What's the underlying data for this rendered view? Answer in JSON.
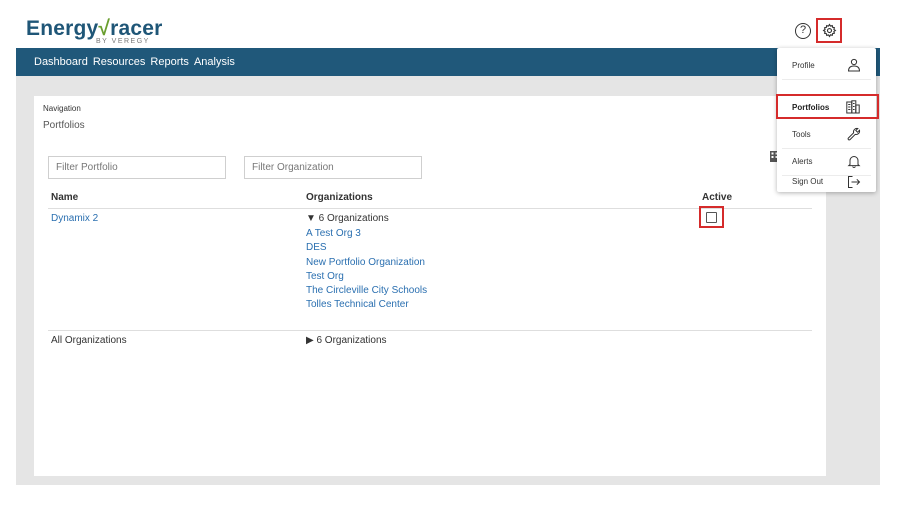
{
  "header": {
    "logo_main": "Energy",
    "logo_check": "√",
    "logo_rest": "racer",
    "logo_sub": "BY VEREGY",
    "help_glyph": "?"
  },
  "nav": {
    "items": [
      {
        "label": "Dashboard"
      },
      {
        "label": "Resources"
      },
      {
        "label": "Reports"
      },
      {
        "label": "Analysis"
      }
    ]
  },
  "page": {
    "nav_label": "Navigation",
    "title": "Portfolios"
  },
  "filters": {
    "portfolio_placeholder": "Filter Portfolio",
    "organization_placeholder": "Filter Organization"
  },
  "table": {
    "headers": {
      "name": "Name",
      "organizations": "Organizations",
      "active": "Active"
    },
    "rows": [
      {
        "name": "Dynamix 2",
        "org_toggle": "▼ 6 Organizations",
        "organizations": [
          "A Test Org 3",
          "DES",
          "New Portfolio Organization",
          "Test Org",
          "The Circleville City Schools",
          "Tolles Technical Center"
        ],
        "active": false
      },
      {
        "name": "All Organizations",
        "org_toggle": "▶ 6 Organizations"
      }
    ]
  },
  "menu": {
    "items": [
      {
        "label": "Profile",
        "icon": "person-icon"
      },
      {
        "label": "Portfolios",
        "icon": "buildings-icon",
        "selected": true
      },
      {
        "label": "Tools",
        "icon": "wrench-icon"
      },
      {
        "label": "Alerts",
        "icon": "bell-icon"
      },
      {
        "label": "Sign Out",
        "icon": "sign-out-icon"
      }
    ]
  },
  "colors": {
    "navbar": "#20587a",
    "link": "#2a6fb0",
    "highlight": "#d52b2b",
    "logo_blue": "#1f5677",
    "logo_green": "#6a9e2f"
  }
}
